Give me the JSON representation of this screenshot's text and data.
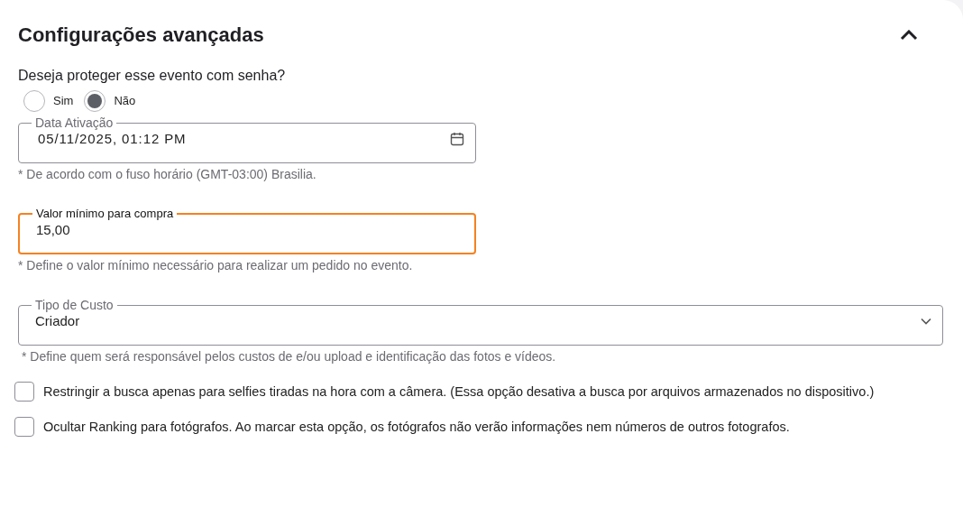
{
  "section": {
    "title": "Configurações avançadas",
    "expanded": true
  },
  "password": {
    "question": "Deseja proteger esse evento com senha?",
    "options": [
      {
        "label": "Sim",
        "selected": false
      },
      {
        "label": "Não",
        "selected": true
      }
    ]
  },
  "fields": [
    {
      "kind": "date",
      "label": "Data Ativação",
      "value": "05/11/2025, 01:12 PM",
      "hint": "* De acordo com o fuso horário (GMT-03:00) Brasilia.",
      "focused": false
    },
    {
      "kind": "text",
      "label": "Valor mínimo para compra",
      "value": "15,00",
      "hint": "* Define o valor mínimo necessário para realizar um pedido no evento.",
      "focused": true
    },
    {
      "kind": "select",
      "label": "Tipo de Custo",
      "value": "Criador",
      "hint": "* Define quem será responsável pelos custos de e/ou upload e identificação das fotos e vídeos.",
      "focused": false
    }
  ],
  "checkboxes": [
    {
      "label": "Restringir a busca apenas para selfies tiradas na hora com a câmera. (Essa opção desativa a busca por arquivos armazenados no dispositivo.)",
      "checked": false
    },
    {
      "label": "Ocultar Ranking para fotógrafos. Ao marcar esta opção, os fotógrafos não verão informações nem números de outros fotografos.",
      "checked": false
    }
  ]
}
